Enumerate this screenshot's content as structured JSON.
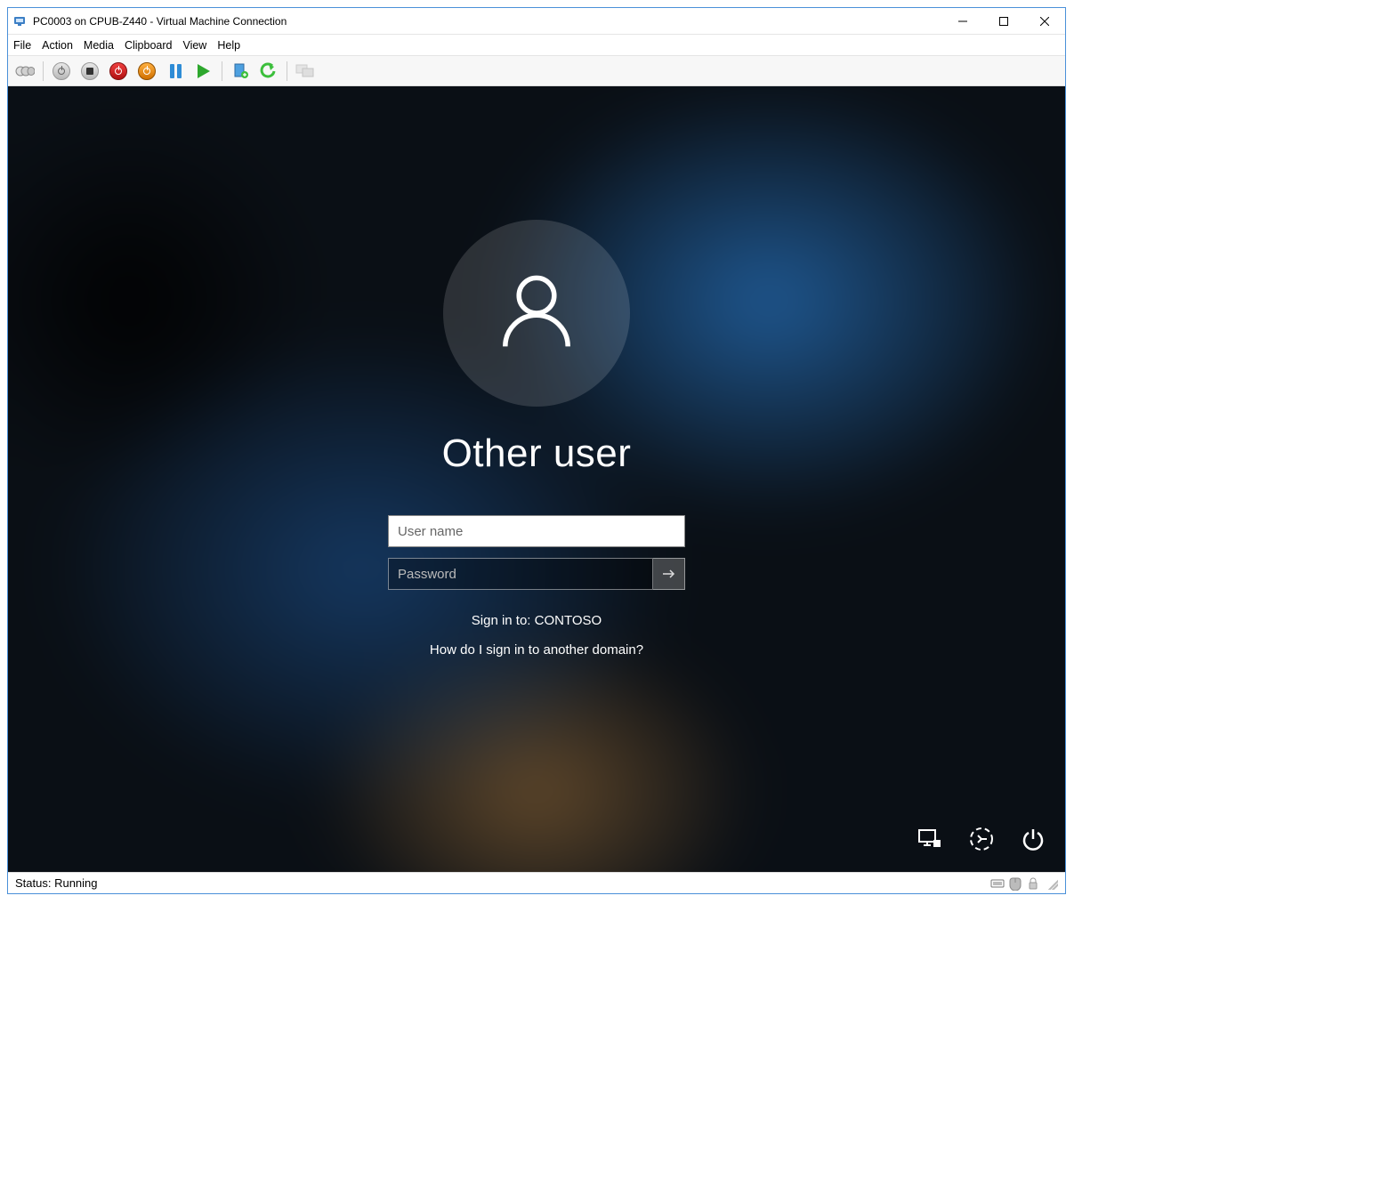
{
  "window": {
    "title": "PC0003 on CPUB-Z440 - Virtual Machine Connection"
  },
  "menu": {
    "file": "File",
    "action": "Action",
    "media": "Media",
    "clipboard": "Clipboard",
    "view": "View",
    "help": "Help"
  },
  "login": {
    "user_label": "Other user",
    "username_placeholder": "User name",
    "password_placeholder": "Password",
    "signin_to": "Sign in to: CONTOSO",
    "domain_hint": "How do I sign in to another domain?"
  },
  "status": {
    "text": "Status: Running"
  }
}
